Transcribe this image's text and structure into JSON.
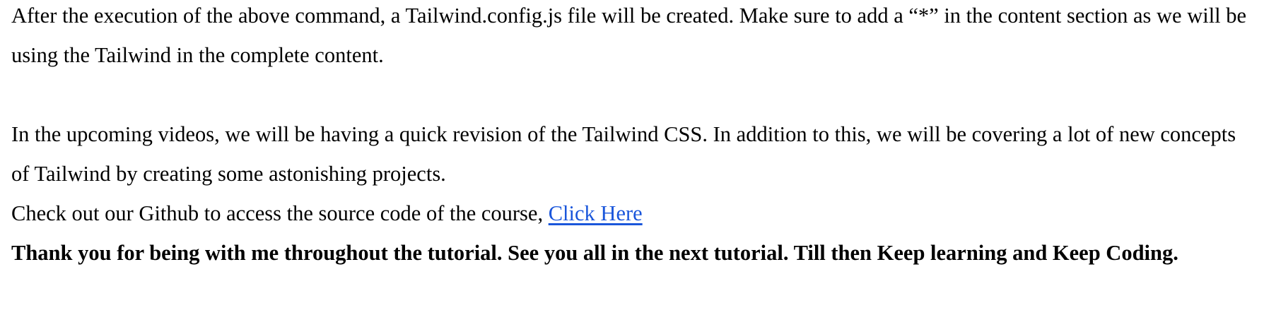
{
  "paragraphs": {
    "p1": "After the execution of the above command, a Tailwind.config.js file will be created. Make sure to add a “*” in the content section as we will be using the Tailwind in the complete content.",
    "p2": "In the upcoming videos, we will be having a quick revision of the Tailwind CSS. In addition to this, we will be covering a lot of new concepts of Tailwind by creating some astonishing projects.",
    "p3_text": "Check out our Github to access the source code of the course, ",
    "p3_link": "Click Here",
    "p4": "Thank you for being with me throughout the tutorial. See you all in the next tutorial. Till then Keep learning and Keep Coding."
  },
  "colors": {
    "text": "#000000",
    "link": "#1a56db",
    "background": "#ffffff"
  }
}
